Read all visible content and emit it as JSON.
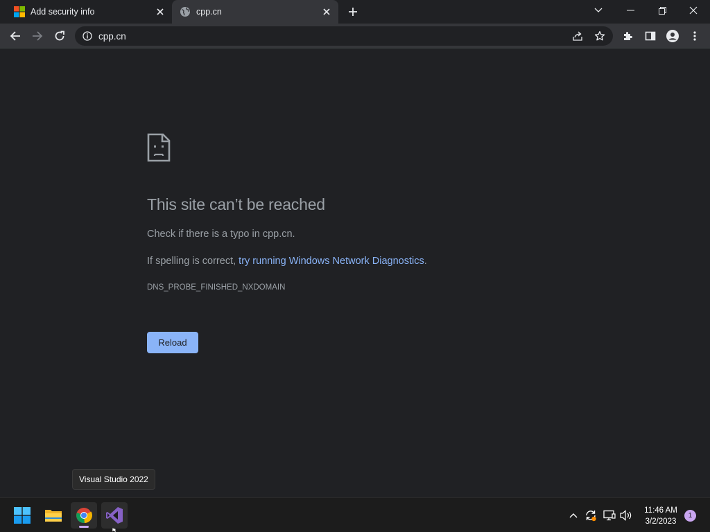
{
  "tabs": [
    {
      "title": "Add security info",
      "favicon": "microsoft-logo-icon"
    },
    {
      "title": "cpp.cn",
      "favicon": "globe-icon"
    }
  ],
  "omnibox": {
    "url": "cpp.cn"
  },
  "error_page": {
    "heading": "This site can’t be reached",
    "line1": "Check if there is a typo in cpp.cn.",
    "line2_prefix": "If spelling is correct, ",
    "line2_link": "try running Windows Network Diagnostics",
    "line2_suffix": ".",
    "error_code": "DNS_PROBE_FINISHED_NXDOMAIN",
    "reload_label": "Reload"
  },
  "tooltip": {
    "text": "Visual Studio 2022"
  },
  "taskbar": {
    "apps": [
      "start-icon",
      "file-explorer-icon",
      "chrome-icon",
      "visual-studio-icon"
    ],
    "clock_time": "11:46 AM",
    "clock_date": "3/2/2023",
    "notification_count": "1"
  },
  "colors": {
    "accent_link": "#8ab4f8",
    "page_bg": "#202124",
    "toolbar_bg": "#35363a"
  }
}
